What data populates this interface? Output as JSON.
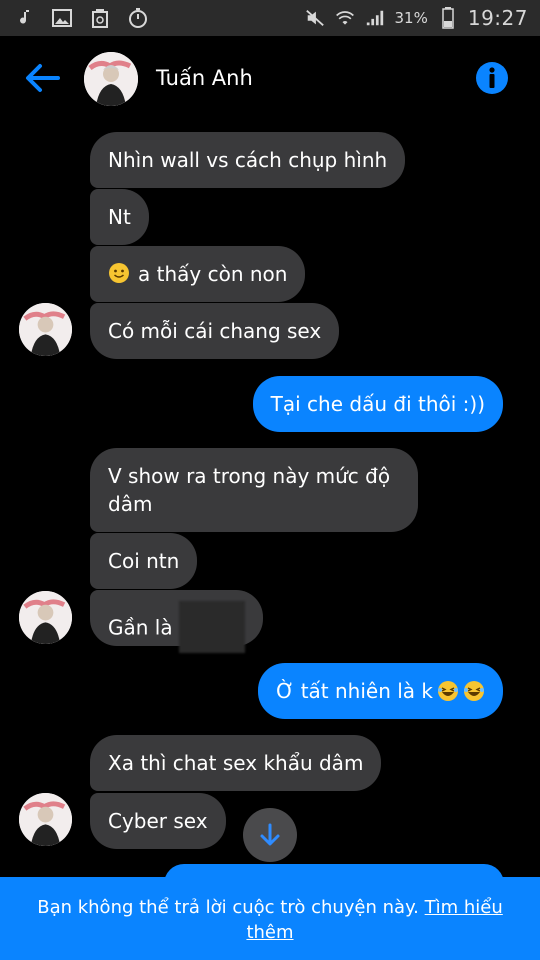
{
  "status_bar": {
    "battery_percent": "31%",
    "time": "19:27"
  },
  "header": {
    "contact_name": "Tuấn Anh"
  },
  "messages": {
    "m1": "Nhìn wall vs cách chụp hình",
    "m2": "Nt",
    "m3": "a thấy còn non",
    "m4": "Có mỗi cái chang sex",
    "m5": "Tại che dấu đi thôi :))",
    "m6": "V show ra trong này mức độ dâm",
    "m7": "Coi ntn",
    "m8": "Gần là",
    "m9": "Ờ tất nhiên là k",
    "m10": "Xa thì chat sex khẩu dâm",
    "m11": "Cyber sex"
  },
  "footer": {
    "notice": "Bạn không thể trả lời cuộc trò chuyện này.",
    "link": "Tìm hiểu thêm"
  },
  "colors": {
    "accent": "#0a84ff",
    "incoming_bubble": "#3a3a3c",
    "background": "#000000"
  }
}
